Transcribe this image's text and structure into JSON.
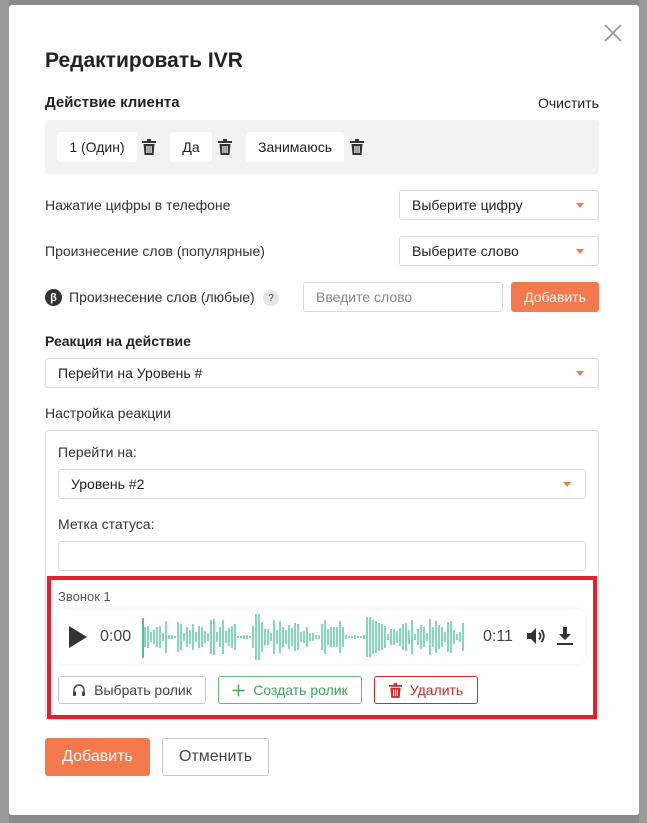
{
  "modal": {
    "title": "Редактировать IVR",
    "close_icon": "close-icon"
  },
  "client_action": {
    "title": "Действие клиента",
    "clear_label": "Очистить",
    "chips": [
      {
        "label": "1 (Один)"
      },
      {
        "label": "Да"
      },
      {
        "label": "Занимаюсь"
      }
    ]
  },
  "digit": {
    "label": "Нажатие цифры в телефоне",
    "selected": "Выберите цифру"
  },
  "popular_words": {
    "label": "Произнесение слов (популярные)",
    "selected": "Выберите слово"
  },
  "any_words": {
    "beta": "β",
    "label": "Произнесение слов (любые)",
    "help": "?",
    "placeholder": "Введите слово",
    "add_label": "Добавить"
  },
  "reaction": {
    "title": "Реакция на действие",
    "selected": "Перейти на Уровень #"
  },
  "reaction_settings": {
    "title": "Настройка реакции",
    "goto_label": "Перейти на:",
    "goto_selected": "Уровень #2",
    "status_label": "Метка статуса:",
    "status_value": ""
  },
  "call": {
    "title": "Звонок 1",
    "current_time": "0:00",
    "duration": "0:11",
    "progress": 0,
    "choose_label": "Выбрать ролик",
    "create_label": "Создать ролик",
    "delete_label": "Удалить"
  },
  "footer": {
    "add_label": "Добавить",
    "cancel_label": "Отменить"
  },
  "colors": {
    "accent": "#f47a4e",
    "highlight": "#e3202e",
    "wave": "#86d6bd",
    "create": "#3da15a",
    "delete": "#cc2b2b"
  }
}
